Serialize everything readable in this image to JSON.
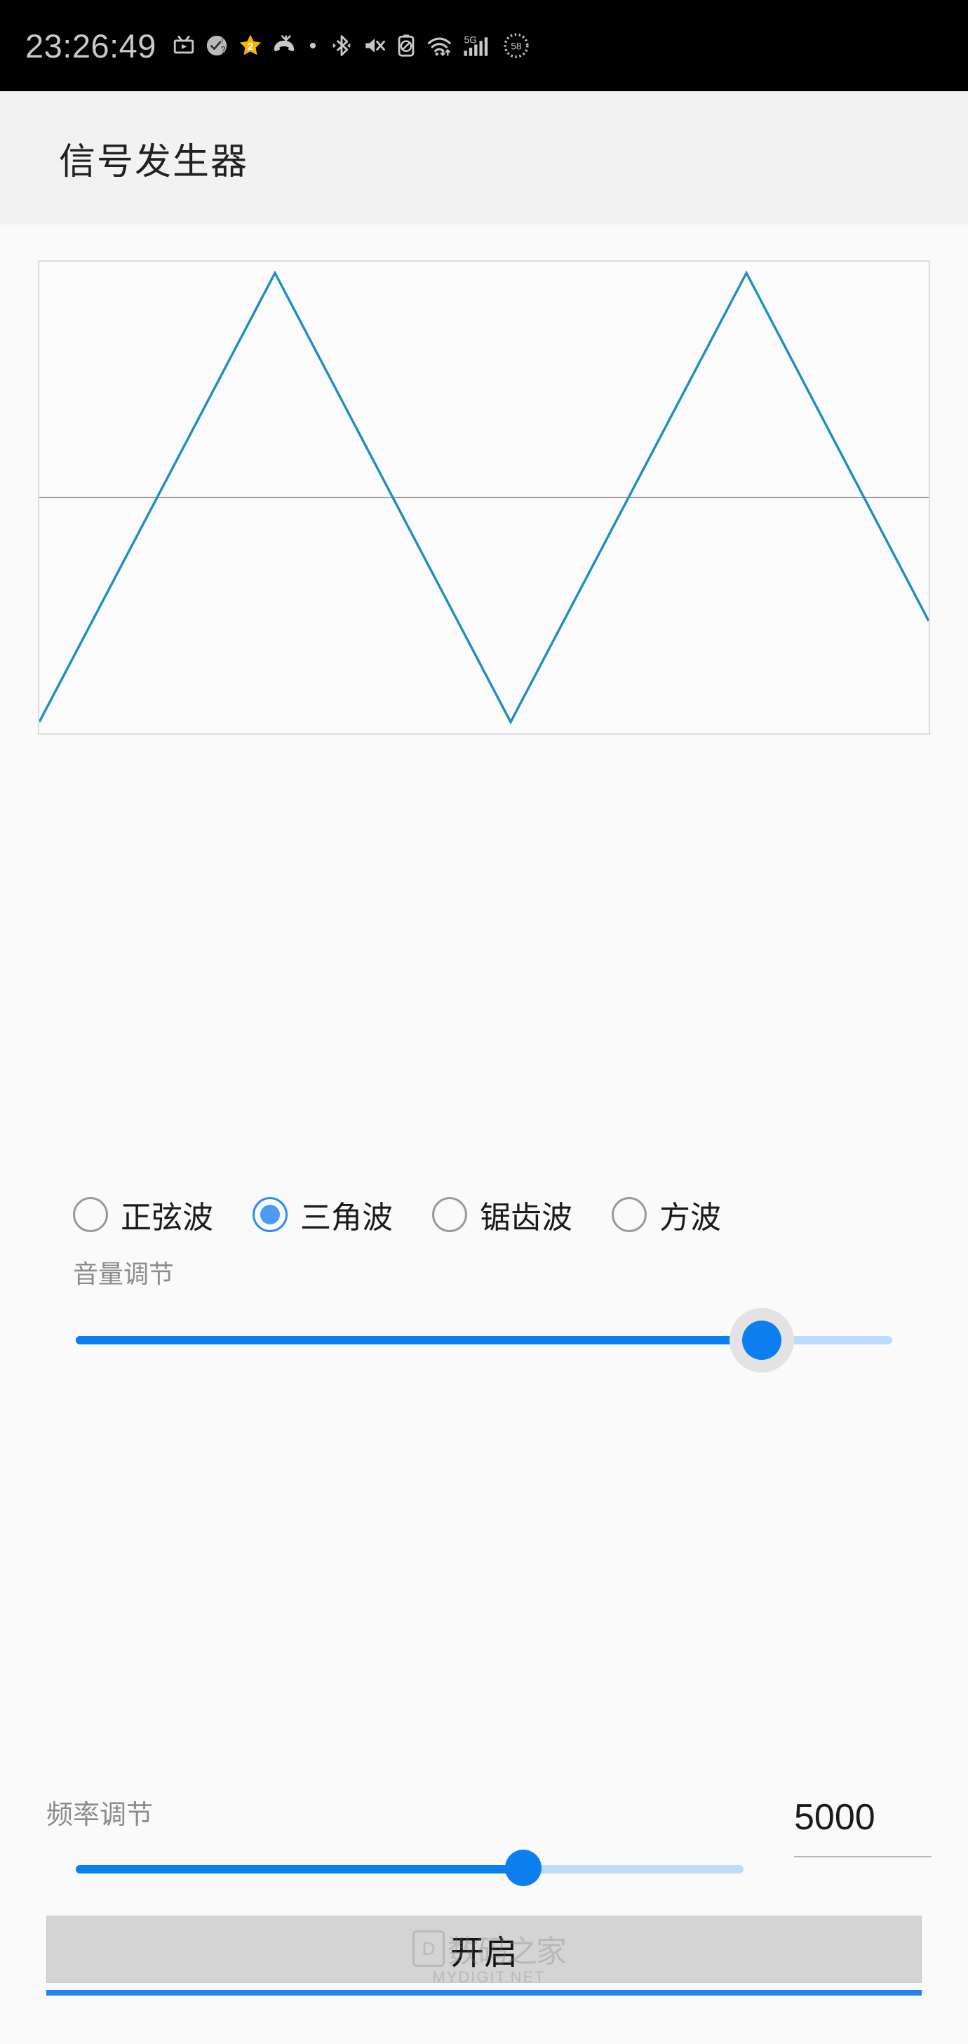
{
  "statusbar": {
    "time": "23:26:49",
    "icons": [
      {
        "name": "tv-cast-icon",
        "label": "tv-cast"
      },
      {
        "name": "task-check-icon",
        "label": "task-check"
      },
      {
        "name": "star-badge-icon",
        "label": "star-badge",
        "badge": "2",
        "color": "#f5b800"
      },
      {
        "name": "missed-call-icon",
        "label": "missed-call"
      },
      {
        "name": "dot-icon",
        "label": "dot"
      },
      {
        "name": "bluetooth-icon",
        "label": "bluetooth"
      },
      {
        "name": "volume-mute-icon",
        "label": "volume-mute"
      },
      {
        "name": "battery-saver-icon",
        "label": "battery-saver"
      },
      {
        "name": "wifi-icon",
        "label": "wifi"
      },
      {
        "name": "signal-5g-icon",
        "label": "5G",
        "text": "5G"
      },
      {
        "name": "battery-percent-icon",
        "label": "battery-percent",
        "text": "58"
      }
    ]
  },
  "appbar": {
    "title": "信号发生器"
  },
  "chart_data": {
    "type": "line",
    "title": "",
    "xlabel": "",
    "ylabel": "",
    "waveform": "triangle",
    "series": [
      {
        "name": "三角波",
        "color": "#1c8fc0",
        "points_pct": [
          [
            0.0,
            0.0
          ],
          [
            0.265,
            1.0
          ],
          [
            0.53,
            0.0
          ],
          [
            0.795,
            1.0
          ],
          [
            1.0,
            0.225
          ]
        ]
      }
    ],
    "axis": {
      "zero_line_pct": 0.5,
      "grid": false,
      "ylim": [
        0,
        1
      ],
      "xlim": [
        0,
        1
      ]
    },
    "zero_line_color": "#9e9e9e",
    "border_color": "#dddddd",
    "legend": "none"
  },
  "waveform_options": {
    "selected": "三角波",
    "items": [
      {
        "label": "正弦波",
        "selected": false
      },
      {
        "label": "三角波",
        "selected": true
      },
      {
        "label": "锯齿波",
        "selected": false
      },
      {
        "label": "方波",
        "selected": false
      }
    ]
  },
  "volume": {
    "label": "音量调节",
    "percent": 84,
    "fill_color": "#0b7ef0",
    "track_color": "#bcdcfb"
  },
  "frequency": {
    "label": "频率调节",
    "value": "5000",
    "percent": 67,
    "fill_color": "#0b7ef0",
    "track_color": "#bcdcfb"
  },
  "action": {
    "start_label": "开启"
  },
  "watermark": {
    "mark": "D",
    "cn": "数码之家",
    "site": "MYDIGIT.NET"
  }
}
